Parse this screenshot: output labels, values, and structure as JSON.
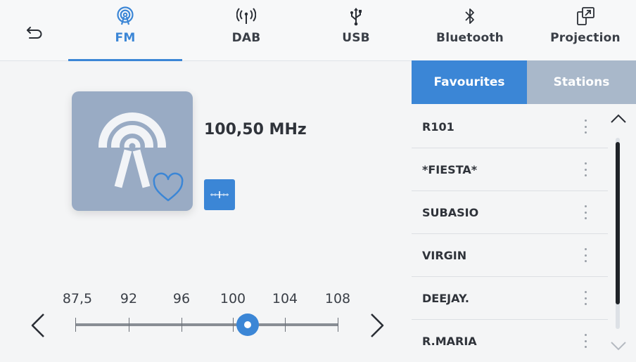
{
  "header": {
    "tabs": [
      {
        "label": "FM",
        "icon": "fm-radio-icon",
        "active": true
      },
      {
        "label": "DAB",
        "icon": "dab-antenna-icon",
        "active": false
      },
      {
        "label": "USB",
        "icon": "usb-icon",
        "active": false
      },
      {
        "label": "Bluetooth",
        "icon": "bluetooth-icon",
        "active": false
      },
      {
        "label": "Projection",
        "icon": "projection-icon",
        "active": false
      }
    ]
  },
  "player": {
    "frequency": "100,50 MHz",
    "favourite": false
  },
  "scale": {
    "labels": [
      "87,5",
      "92",
      "96",
      "100",
      "104",
      "108"
    ],
    "current": 100.5
  },
  "panel": {
    "tabs": [
      "Favourites",
      "Stations"
    ],
    "active_tab": "Favourites",
    "stations": [
      "R101",
      "*FIESTA*",
      "SUBASIO",
      "VIRGIN",
      "DEEJAY.",
      "R.MARIA"
    ],
    "scroll_position": 0.15,
    "scroll_visible_fraction": 0.85
  },
  "colors": {
    "accent": "#3b86d6",
    "artwork": "#99abc4",
    "inactive_tab": "#a9b8ca"
  }
}
